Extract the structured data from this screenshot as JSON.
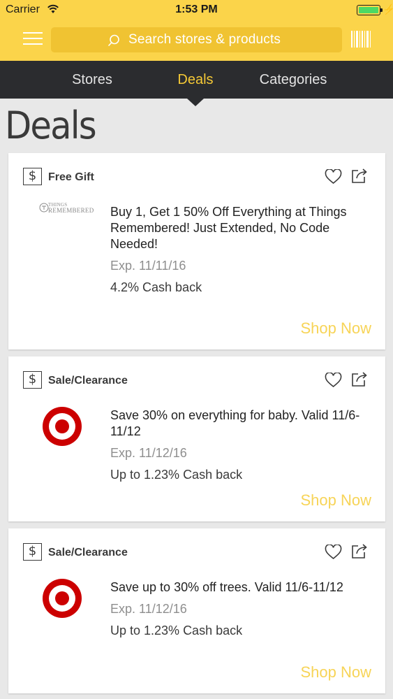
{
  "status_bar": {
    "carrier": "Carrier",
    "time": "1:53 PM",
    "battery_level": 1.0
  },
  "header": {
    "search_placeholder": "Search stores & products",
    "menu_icon": "hamburger-menu-icon",
    "search_icon": "search-icon",
    "barcode_icon": "barcode-icon"
  },
  "nav": {
    "tabs": [
      {
        "label": "Stores",
        "active": false
      },
      {
        "label": "Deals",
        "active": true
      },
      {
        "label": "Categories",
        "active": false
      }
    ]
  },
  "page": {
    "title": "Deals"
  },
  "colors": {
    "accent": "#fbd44a",
    "nav_bg": "#2b2c2f",
    "active_tab": "#f5c936",
    "shop_now": "#f7d457",
    "target_red": "#cc0000"
  },
  "deals": [
    {
      "type": "Free Gift",
      "store_logo": "things-remembered-logo",
      "logo_text_top": "THINGS",
      "logo_text_bottom": "REMEMBERED",
      "title": "Buy 1, Get 1 50% Off Everything at Things Remembered! Just Extended, No Code Needed!",
      "expires": "Exp. 11/11/16",
      "cashback": "4.2% Cash back",
      "cta": "Shop Now"
    },
    {
      "type": "Sale/Clearance",
      "store_logo": "target-logo",
      "title": "Save 30% on everything for baby. Valid 11/6-11/12",
      "expires": "Exp. 11/12/16",
      "cashback": "Up to 1.23% Cash back",
      "cta": "Shop Now"
    },
    {
      "type": "Sale/Clearance",
      "store_logo": "target-logo",
      "title": "Save up to 30% off trees. Valid 11/6-11/12",
      "expires": "Exp. 11/12/16",
      "cashback": "Up to 1.23% Cash back",
      "cta": "Shop Now"
    }
  ]
}
